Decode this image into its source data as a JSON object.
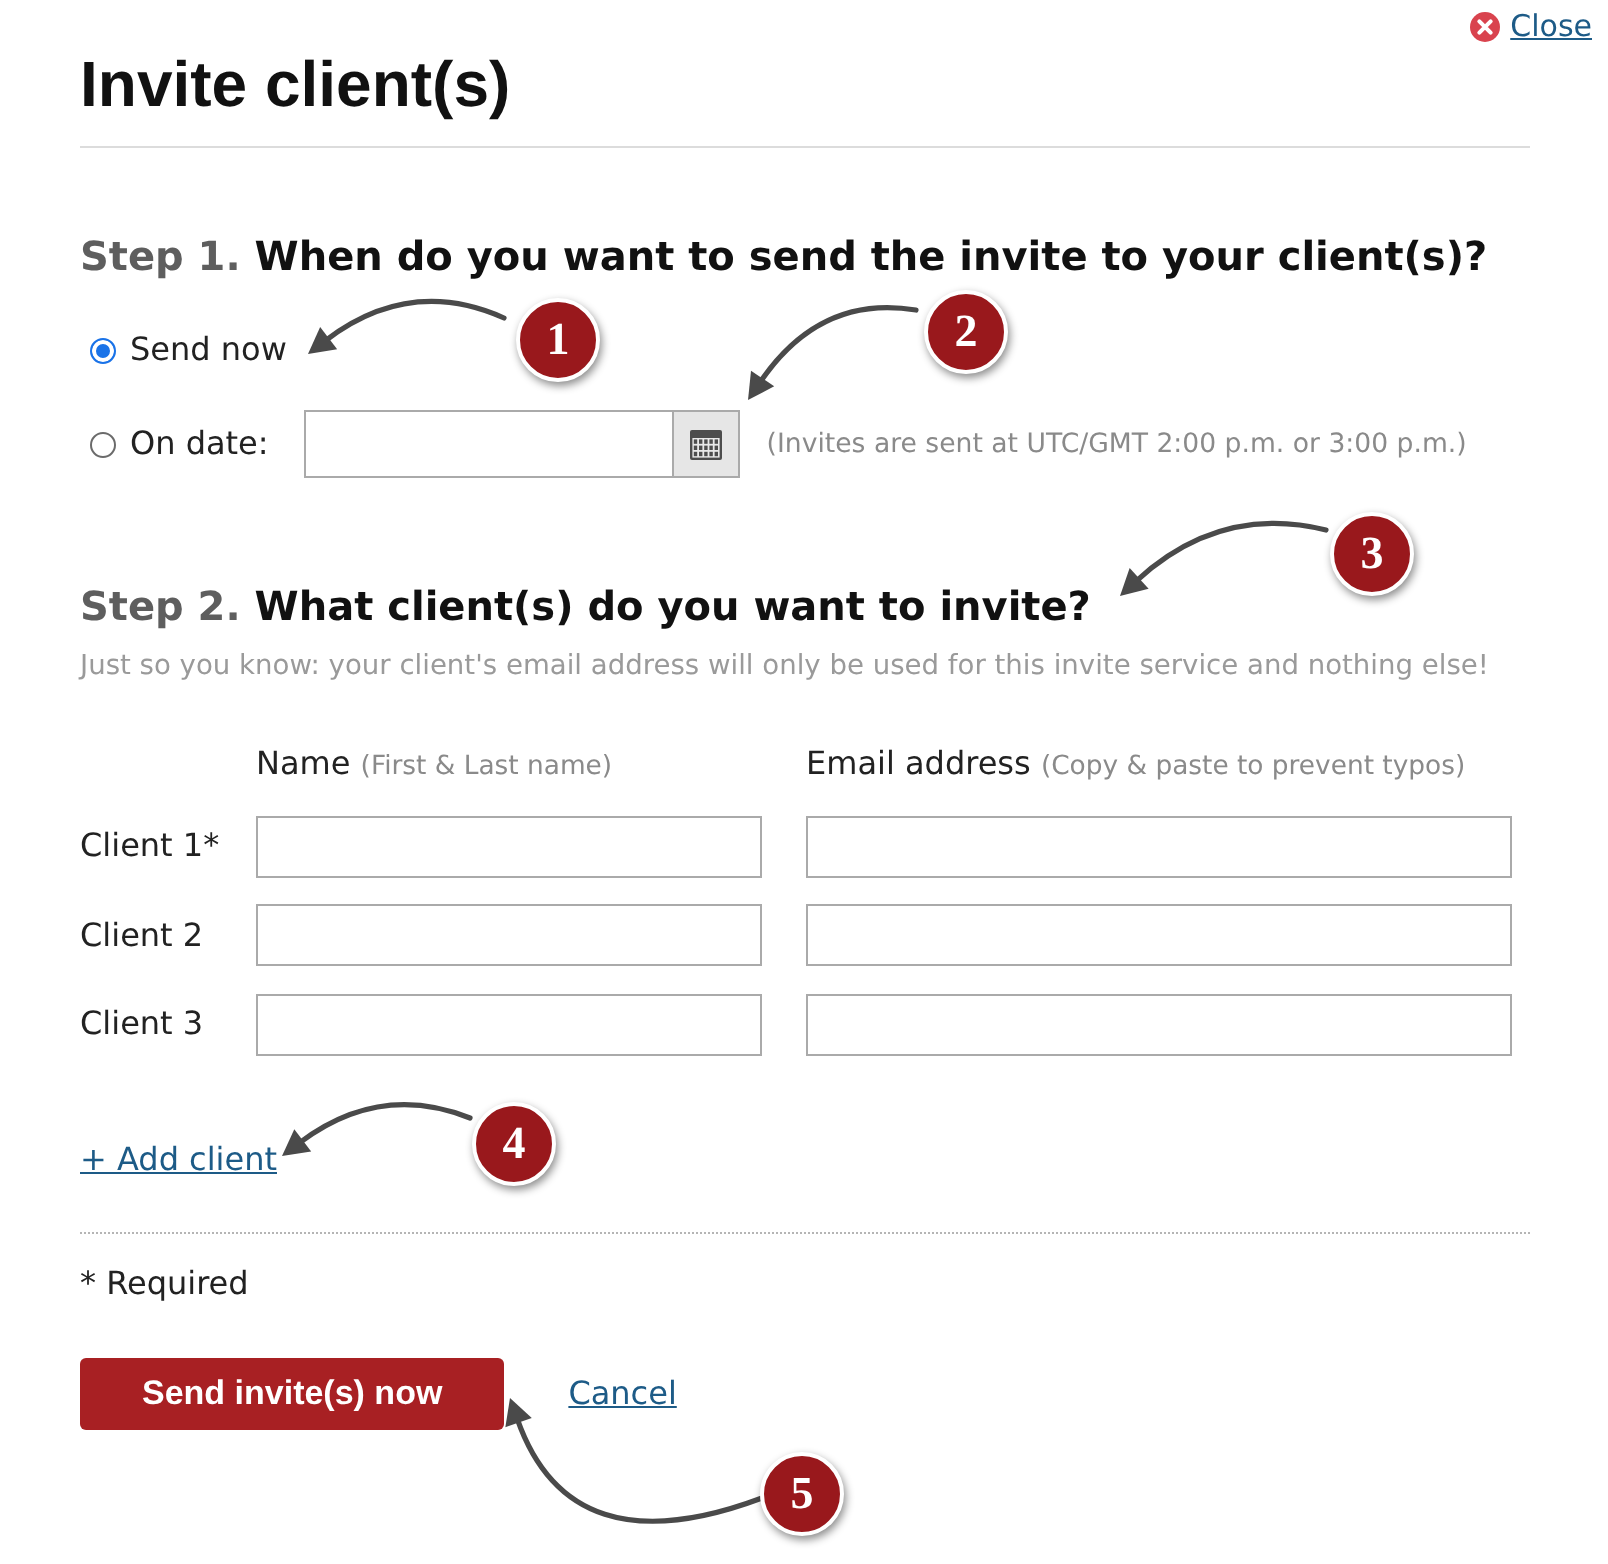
{
  "close_link": {
    "label": "Close"
  },
  "title": "Invite client(s)",
  "step1": {
    "step": "Step 1.",
    "question": "When do you want to send the invite to your client(s)?",
    "options": [
      {
        "kind": "plain",
        "label": "Send now",
        "selected": true
      },
      {
        "kind": "date",
        "label": "On date:",
        "selected": false,
        "hint": "(Invites are sent at UTC/GMT 2:00 p.m. or 3:00 p.m.)"
      }
    ]
  },
  "step2": {
    "step": "Step 2.",
    "question": "What client(s) do you want to invite?",
    "note": "Just so you know: your client's email address will only be used for this invite service and nothing else!",
    "columns": [
      {
        "label": "Name",
        "hint": "(First & Last name)"
      },
      {
        "label": "Email address",
        "hint": "(Copy & paste to prevent typos)"
      }
    ],
    "clients": [
      {
        "label": "Client 1*"
      },
      {
        "label": "Client 2"
      },
      {
        "label": "Client 3"
      }
    ],
    "add_link": "+ Add client"
  },
  "required_note": "* Required",
  "actions": {
    "submit": "Send invite(s) now",
    "cancel": "Cancel"
  },
  "callouts": [
    {
      "number": "1"
    },
    {
      "number": "2"
    },
    {
      "number": "3"
    },
    {
      "number": "4"
    },
    {
      "number": "5"
    }
  ]
}
